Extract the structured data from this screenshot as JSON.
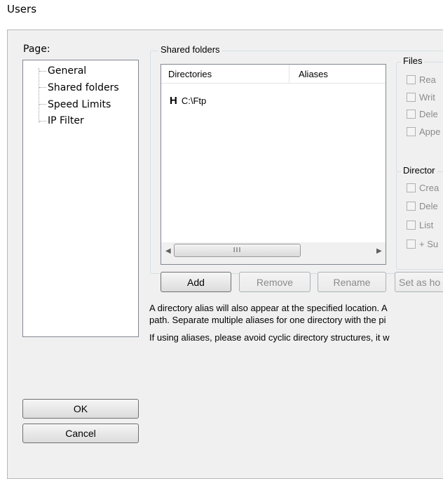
{
  "window": {
    "title": "Users"
  },
  "page_tree": {
    "label": "Page:",
    "items": [
      {
        "label": "General"
      },
      {
        "label": "Shared folders"
      },
      {
        "label": "Speed Limits"
      },
      {
        "label": "IP Filter"
      }
    ]
  },
  "buttons": {
    "ok": "OK",
    "cancel": "Cancel"
  },
  "shared_folders": {
    "group_title": "Shared folders",
    "columns": [
      "Directories",
      "Aliases"
    ],
    "rows": [
      {
        "home_flag": "H",
        "directory": "C:\\Ftp",
        "alias": ""
      }
    ],
    "scroll_grip": "III",
    "actions": {
      "add": "Add",
      "remove": "Remove",
      "rename": "Rename",
      "set_home": "Set as ho"
    }
  },
  "files_group": {
    "title": "Files",
    "options": [
      "Rea",
      "Writ",
      "Dele",
      "Appe"
    ]
  },
  "directories_group": {
    "title": "Director",
    "options": [
      "Crea",
      "Dele",
      "List",
      "+ Su"
    ]
  },
  "info": {
    "line1": "A directory alias will also appear at the specified location. A",
    "line2": "path. Separate multiple aliases for one directory with the pi",
    "line3": "If using aliases, please avoid cyclic directory structures, it w"
  }
}
